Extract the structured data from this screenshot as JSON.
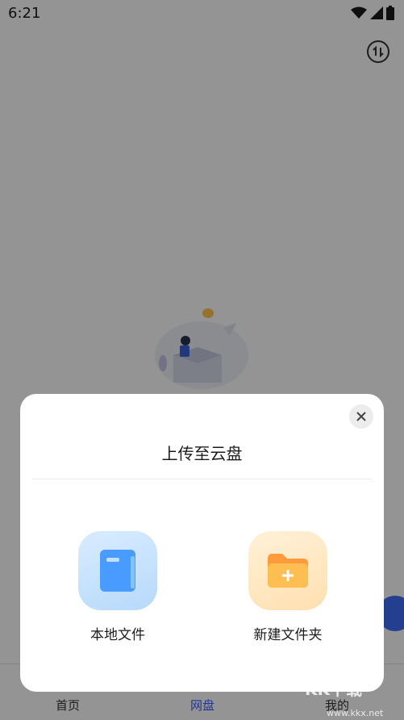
{
  "status_bar": {
    "time": "6:21",
    "icons": [
      "wifi-icon",
      "signal-icon",
      "battery-icon"
    ]
  },
  "top_bar": {
    "transfer_icon": "transfer-icon"
  },
  "bottom_nav": {
    "items": [
      {
        "label": "首页",
        "icon": "home-icon"
      },
      {
        "label": "网盘",
        "icon": "cloud-disk-icon",
        "active": true
      },
      {
        "label": "我的",
        "icon": "profile-icon"
      }
    ]
  },
  "upload_sheet": {
    "title": "上传至云盘",
    "options": [
      {
        "label": "本地文件",
        "icon": "local-file-icon"
      },
      {
        "label": "新建文件夹",
        "icon": "new-folder-icon"
      }
    ],
    "close_icon": "close-icon"
  },
  "watermark": {
    "text": "KK下载",
    "url": "www.kkx.net"
  },
  "colors": {
    "accent": "#3b5bff",
    "overlay": "#000000",
    "tile_blue": "#b6d9fb",
    "tile_orange": "#ffe0b0"
  }
}
